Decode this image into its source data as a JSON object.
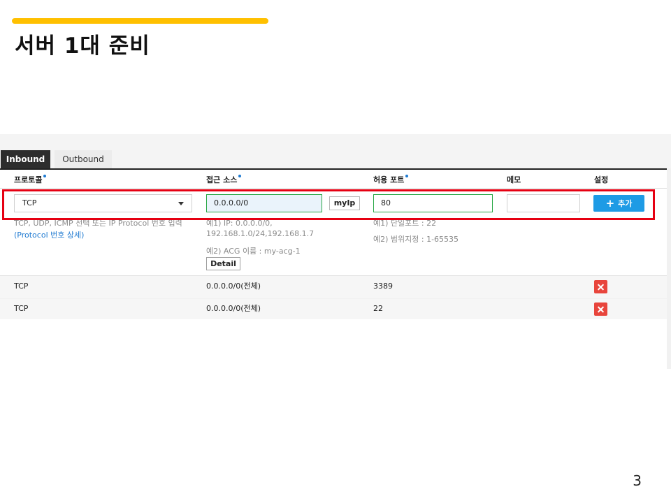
{
  "slide": {
    "title": "서버 1대 준비",
    "page_number": "3",
    "accent_color": "#ffc000"
  },
  "tabs": [
    {
      "label": "Inbound",
      "active": true
    },
    {
      "label": "Outbound",
      "active": false
    }
  ],
  "columns": {
    "protocol": "프로토콜",
    "source": "접근 소스",
    "port": "허용 포트",
    "memo": "메모",
    "settings": "설정"
  },
  "form": {
    "protocol_value": "TCP",
    "source_value": "0.0.0.0/0",
    "myip_label": "myIp",
    "port_value": "80",
    "memo_value": "",
    "add_label": "추가",
    "add_icon": "plus-icon",
    "highlight_color": "#e60012"
  },
  "hints": {
    "protocol_line1": "TCP, UDP, ICMP 선택 또는 IP Protocol 번호 입력",
    "protocol_link": "(Protocol 번호 상세)",
    "source_line1": "예1) IP: 0.0.0.0/0,",
    "source_line2": "192.168.1.0/24,192.168.1.7",
    "source_line3": "예2) ACG 이름 : my-acg-1",
    "detail_label": "Detail",
    "port_line1": "예1) 단일포트 : 22",
    "port_line2": "예2) 범위지정 : 1-65535"
  },
  "rules": [
    {
      "protocol": "TCP",
      "source": "0.0.0.0/0(전체)",
      "port": "3389"
    },
    {
      "protocol": "TCP",
      "source": "0.0.0.0/0(전체)",
      "port": "22"
    }
  ]
}
